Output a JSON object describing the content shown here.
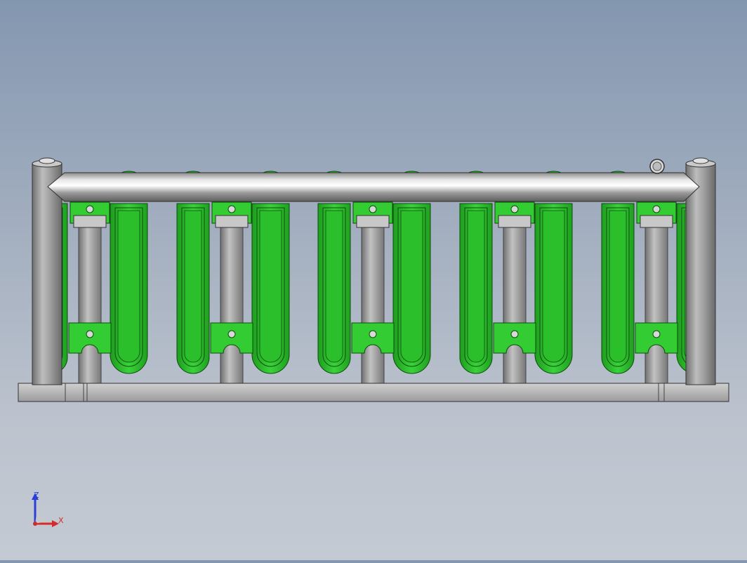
{
  "viewport": {
    "part_color": "#33cc33",
    "metal_color": "#a8a8a8",
    "background_top": "#8497b0",
    "background_bottom": "#c4cad3"
  },
  "triad": {
    "z_label": "Z",
    "x_label": "X",
    "z_color": "#2b3fd6",
    "x_color": "#d62b2b",
    "y_color": "#cc2b2b"
  }
}
